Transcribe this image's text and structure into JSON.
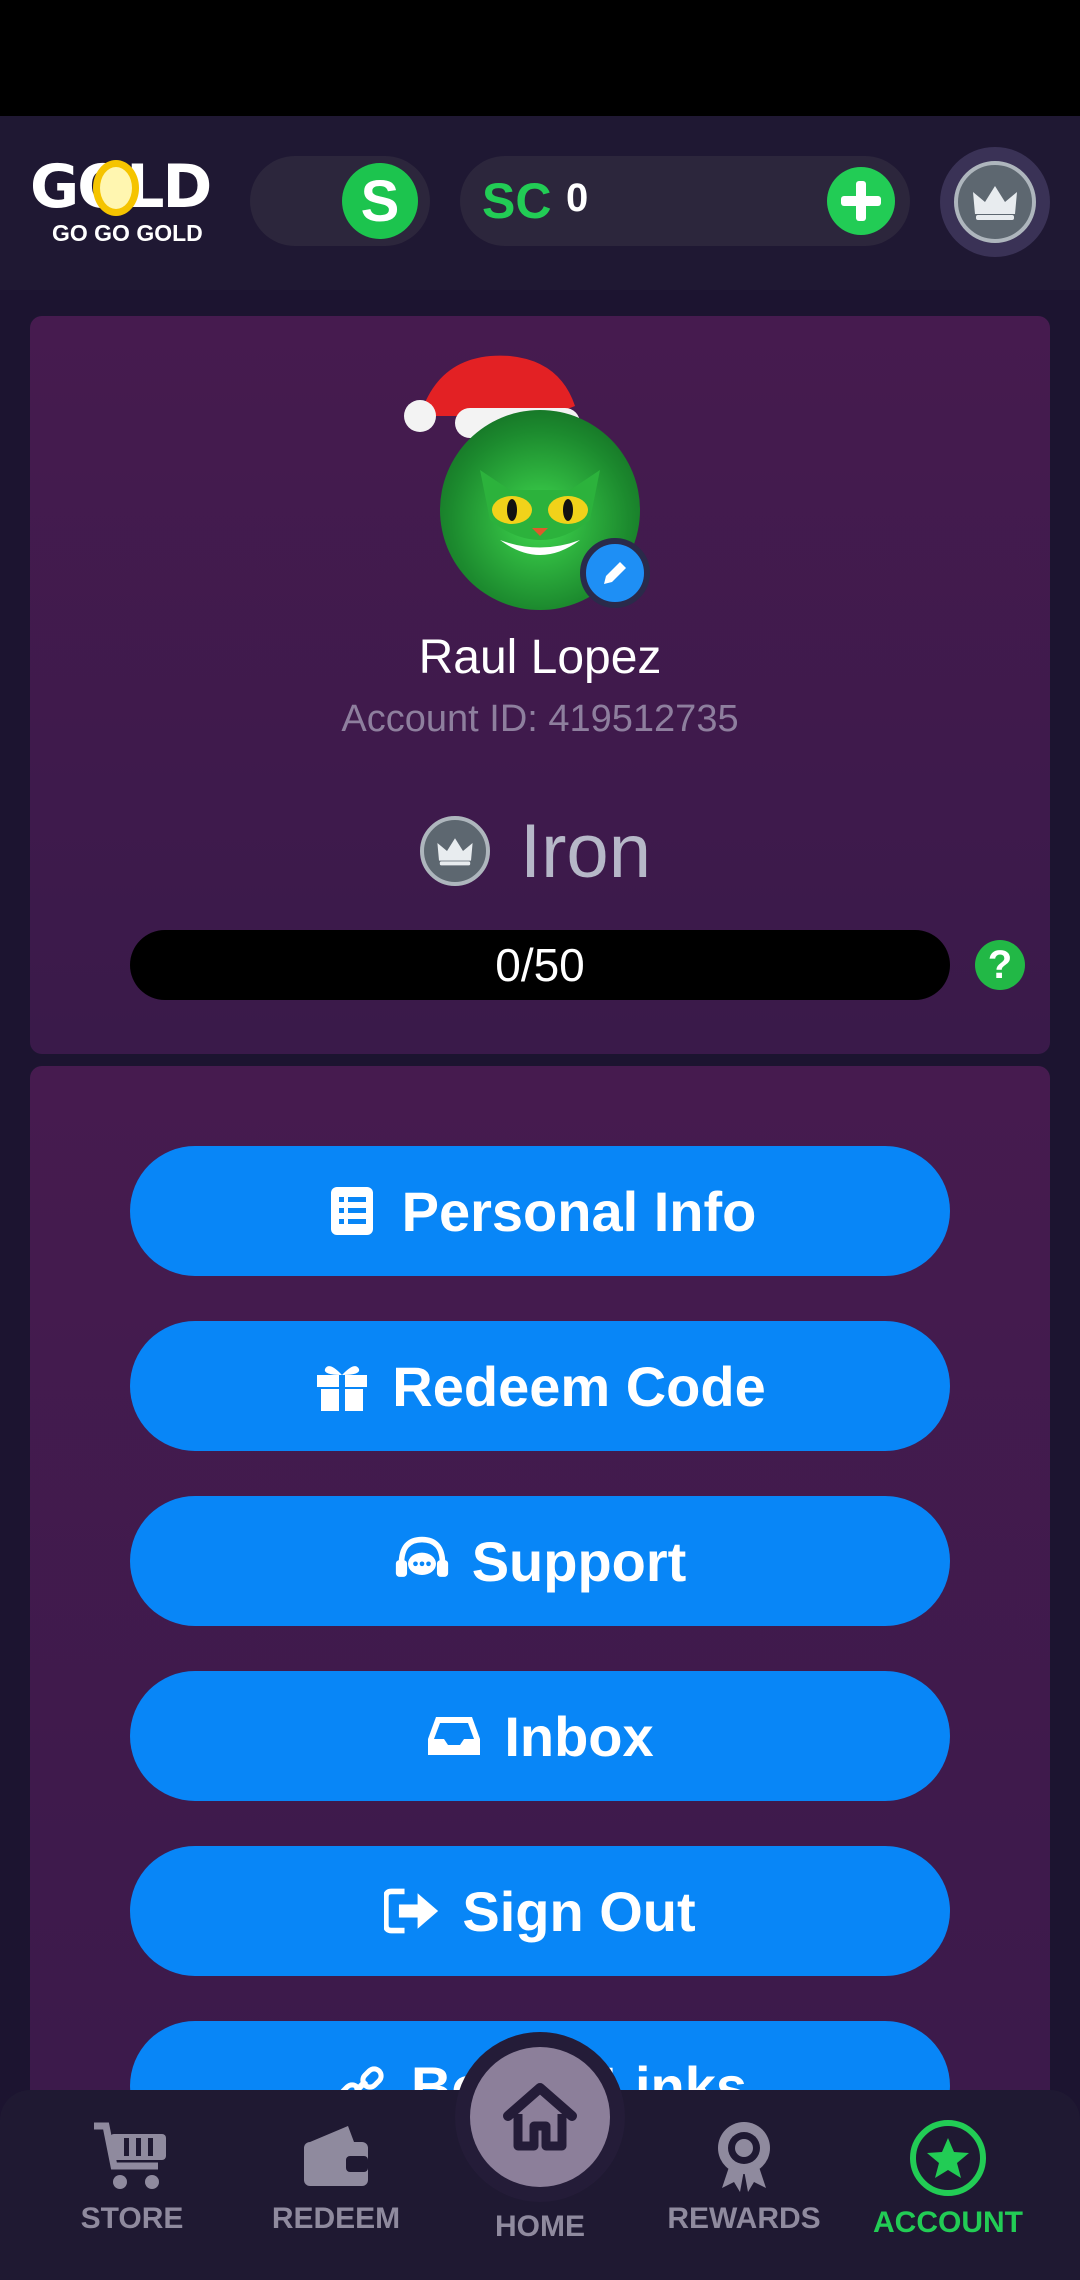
{
  "brand": {
    "logo_word": "GOLD",
    "logo_tagline": "GO GO GOLD"
  },
  "header": {
    "s_coin_symbol": "S",
    "sc_label": "SC",
    "sc_balance": "0"
  },
  "profile": {
    "name": "Raul Lopez",
    "account_id": "Account ID: 419512735",
    "tier": "Iron",
    "progress_text": "0/50",
    "progress_fraction": 0
  },
  "menu": {
    "personal_info": "Personal Info",
    "redeem_code": "Redeem Code",
    "support": "Support",
    "inbox": "Inbox",
    "sign_out": "Sign Out",
    "bonus_links": "Bonus Links"
  },
  "nav": {
    "store": "STORE",
    "redeem": "REDEEM",
    "home": "HOME",
    "rewards": "REWARDS",
    "account": "ACCOUNT",
    "active": "account"
  },
  "colors": {
    "accent_green": "#22cc55",
    "button_blue": "#0886f7",
    "card_purple": "#461b4f",
    "background": "#1c1430"
  }
}
